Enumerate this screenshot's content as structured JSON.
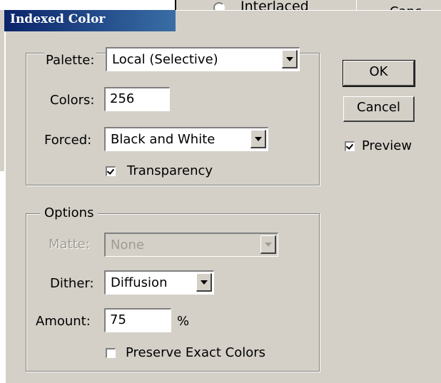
{
  "background_dialog": {
    "interlaced_label": "Interlaced",
    "cancel_label": "Canc"
  },
  "dialog": {
    "title": "Indexed Color",
    "palette": {
      "label": "Palette:",
      "value": "Local (Selective)"
    },
    "colors": {
      "label": "Colors:",
      "value": "256"
    },
    "forced": {
      "label": "Forced:",
      "value": "Black and White"
    },
    "transparency": {
      "label": "Transparency",
      "checked": true
    },
    "options": {
      "legend": "Options",
      "matte": {
        "label": "Matte:",
        "value": "None",
        "enabled": false
      },
      "dither": {
        "label": "Dither:",
        "value": "Diffusion"
      },
      "amount": {
        "label": "Amount:",
        "value": "75",
        "unit": "%"
      },
      "preserve": {
        "label": "Preserve Exact Colors",
        "checked": false
      }
    },
    "buttons": {
      "ok": "OK",
      "cancel": "Cancel"
    },
    "preview": {
      "label": "Preview",
      "checked": true
    }
  }
}
